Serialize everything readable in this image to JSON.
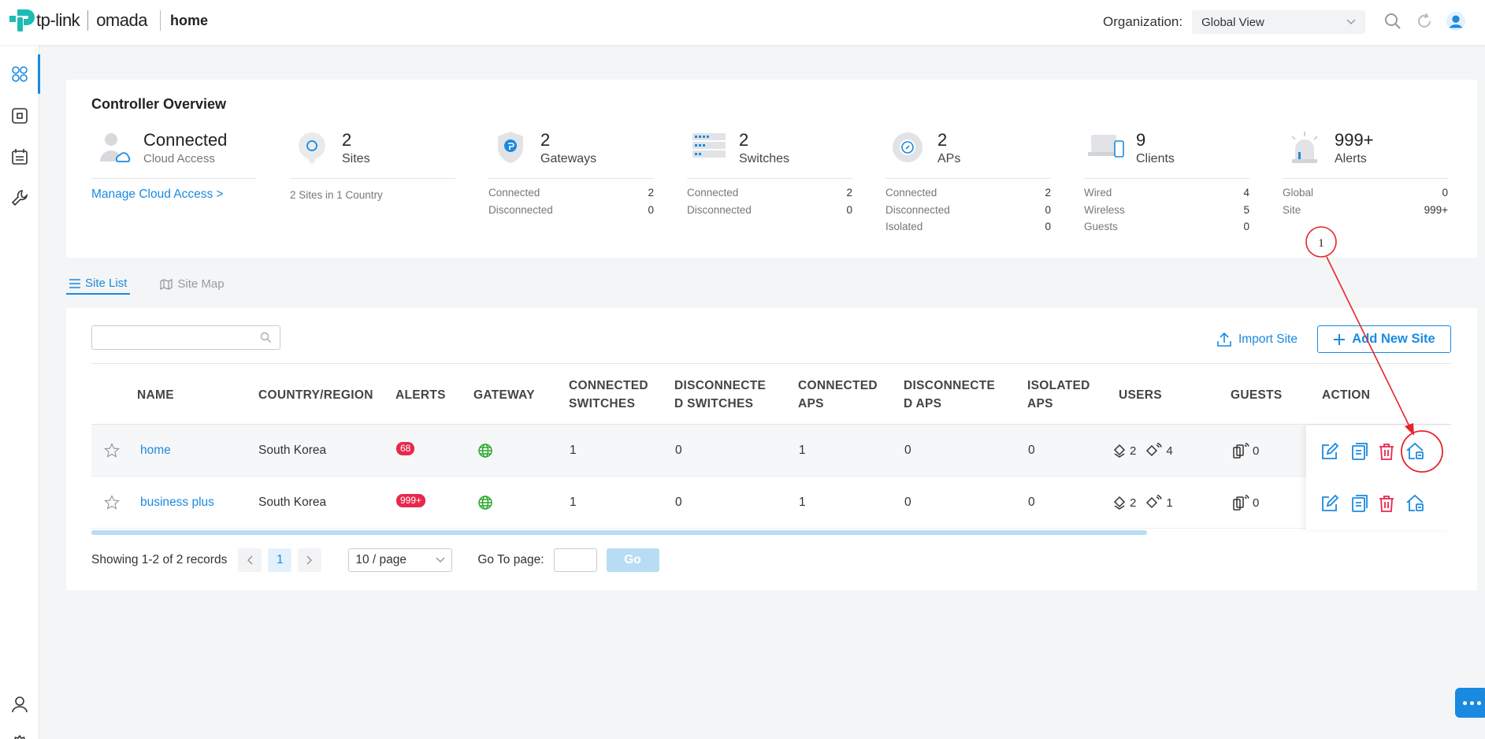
{
  "header": {
    "brand_tp": "tp-link",
    "brand_omada": "omada",
    "site_name": "home",
    "org_label": "Organization:",
    "org_value": "Global View"
  },
  "overview": {
    "title": "Controller Overview",
    "cloud": {
      "status": "Connected",
      "label": "Cloud Access",
      "link": "Manage Cloud Access >"
    },
    "sites": {
      "count": "2",
      "label": "Sites",
      "sub": "2 Sites in 1 Country"
    },
    "gateways": {
      "count": "2",
      "label": "Gateways",
      "rows": [
        {
          "k": "Connected",
          "v": "2"
        },
        {
          "k": "Disconnected",
          "v": "0"
        }
      ]
    },
    "switches": {
      "count": "2",
      "label": "Switches",
      "rows": [
        {
          "k": "Connected",
          "v": "2"
        },
        {
          "k": "Disconnected",
          "v": "0"
        }
      ]
    },
    "aps": {
      "count": "2",
      "label": "APs",
      "rows": [
        {
          "k": "Connected",
          "v": "2"
        },
        {
          "k": "Disconnected",
          "v": "0"
        },
        {
          "k": "Isolated",
          "v": "0"
        }
      ]
    },
    "clients": {
      "count": "9",
      "label": "Clients",
      "rows": [
        {
          "k": "Wired",
          "v": "4"
        },
        {
          "k": "Wireless",
          "v": "5"
        },
        {
          "k": "Guests",
          "v": "0"
        }
      ]
    },
    "alerts": {
      "count": "999+",
      "label": "Alerts",
      "rows": [
        {
          "k": "Global",
          "v": "0"
        },
        {
          "k": "Site",
          "v": "999+"
        }
      ]
    }
  },
  "tabs": {
    "site_list": "Site List",
    "site_map": "Site Map"
  },
  "toolbar": {
    "search_placeholder": "",
    "import": "Import Site",
    "add": "Add New Site"
  },
  "table": {
    "headers": {
      "name": "NAME",
      "country": "COUNTRY/REGION",
      "alerts": "ALERTS",
      "gateway": "GATEWAY",
      "conn_switches_1": "CONNECTED",
      "conn_switches_2": "SWITCHES",
      "disc_switches_1": "DISCONNECTE",
      "disc_switches_2": "D SWITCHES",
      "conn_aps_1": "CONNECTED",
      "conn_aps_2": "APS",
      "disc_aps_1": "DISCONNECTE",
      "disc_aps_2": "D APS",
      "isolated_1": "ISOLATED",
      "isolated_2": "APS",
      "users": "USERS",
      "guests": "GUESTS",
      "action": "ACTION"
    },
    "rows": [
      {
        "name": "home",
        "country": "South Korea",
        "alerts": "68",
        "conn_switches": "1",
        "disc_switches": "0",
        "conn_aps": "1",
        "disc_aps": "0",
        "isolated": "0",
        "wired_users": "2",
        "wireless_users": "4",
        "guests": "0"
      },
      {
        "name": "business plus",
        "country": "South Korea",
        "alerts": "999+",
        "conn_switches": "1",
        "disc_switches": "0",
        "conn_aps": "1",
        "disc_aps": "0",
        "isolated": "0",
        "wired_users": "2",
        "wireless_users": "1",
        "guests": "0"
      }
    ]
  },
  "pagination": {
    "showing": "Showing 1-2 of 2 records",
    "current_page": "1",
    "per_page": "10 / page",
    "goto_label": "Go To page:",
    "go": "Go"
  },
  "annotation": {
    "marker": "1"
  },
  "colors": {
    "accent": "#1a8ae0",
    "alert": "#e8284d",
    "delete": "#e8284d",
    "annotation": "#e5242b"
  }
}
